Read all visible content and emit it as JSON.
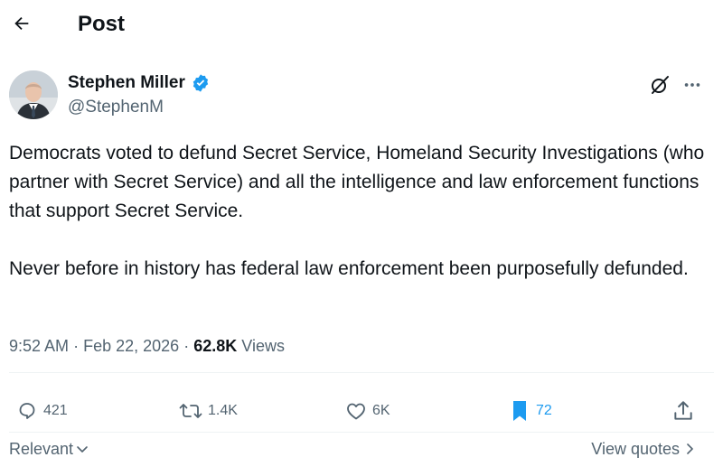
{
  "header": {
    "title": "Post",
    "back_icon": "arrow-left-icon"
  },
  "author": {
    "name": "Stephen Miller",
    "handle": "@StephenM",
    "verified_badge": "verified-badge-icon",
    "verified_color": "#1d9bf0"
  },
  "post": {
    "text": "Democrats voted to defund Secret Service, Homeland Security Investigations (who partner with Secret Service) and all the intelligence and law enforcement functions that support Secret Service.\n\nNever before in history has federal law enforcement been purposefully defunded.",
    "time": "9:52 AM",
    "date": "Feb 22, 2026",
    "separator": "·",
    "views_count": "62.8K",
    "views_label": "Views"
  },
  "actions": {
    "replies": "421",
    "reposts": "1.4K",
    "likes": "6K",
    "bookmarks": "72",
    "bookmark_color": "#1d9bf0"
  },
  "footer": {
    "sort_label": "Relevant",
    "view_quotes_label": "View quotes"
  }
}
